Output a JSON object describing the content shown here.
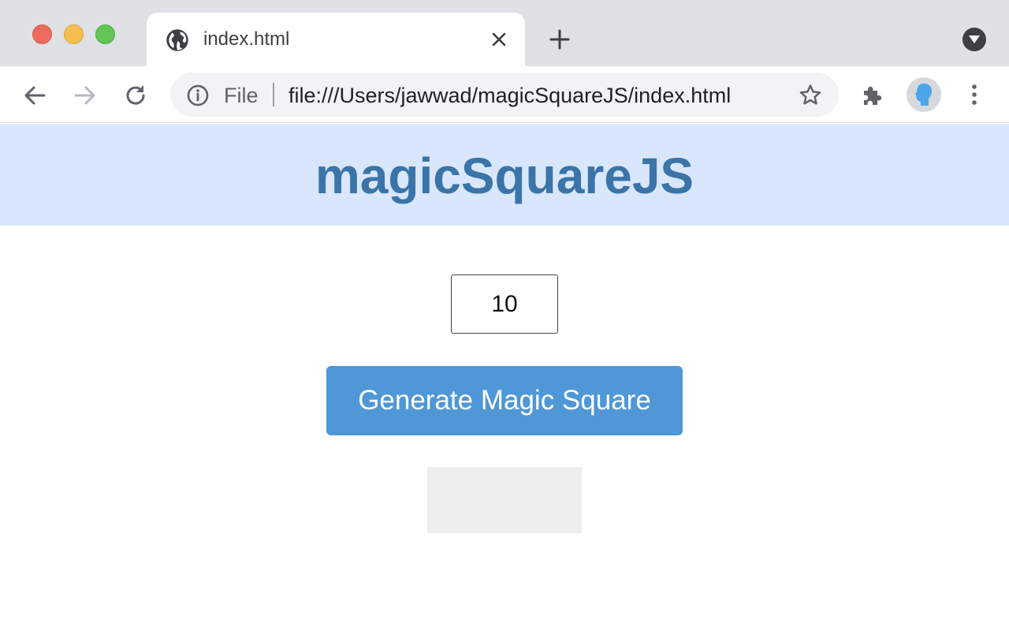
{
  "browser": {
    "tab": {
      "title": "index.html",
      "icon": "globe-icon"
    },
    "omnibox": {
      "scheme_label": "File",
      "url": "file:///Users/jawwad/magicSquareJS/index.html"
    },
    "icons": {
      "back": "back-arrow-icon",
      "forward": "forward-arrow-icon",
      "reload": "reload-icon",
      "info": "info-icon",
      "bookmark": "star-icon",
      "extensions": "puzzle-icon",
      "profile": "avatar",
      "menu": "kebab-menu-icon",
      "new_tab": "plus-icon",
      "tab_search": "chevron-down-icon",
      "close_tab": "close-icon"
    }
  },
  "page": {
    "title": "magicSquareJS",
    "size_input": {
      "value": "10"
    },
    "generate_button": {
      "label": "Generate Magic Square"
    }
  },
  "colors": {
    "header_bg": "#d9e7fc",
    "title_color": "#3b74a8",
    "button_bg": "#4f97d6",
    "result_bg": "#ededed"
  }
}
